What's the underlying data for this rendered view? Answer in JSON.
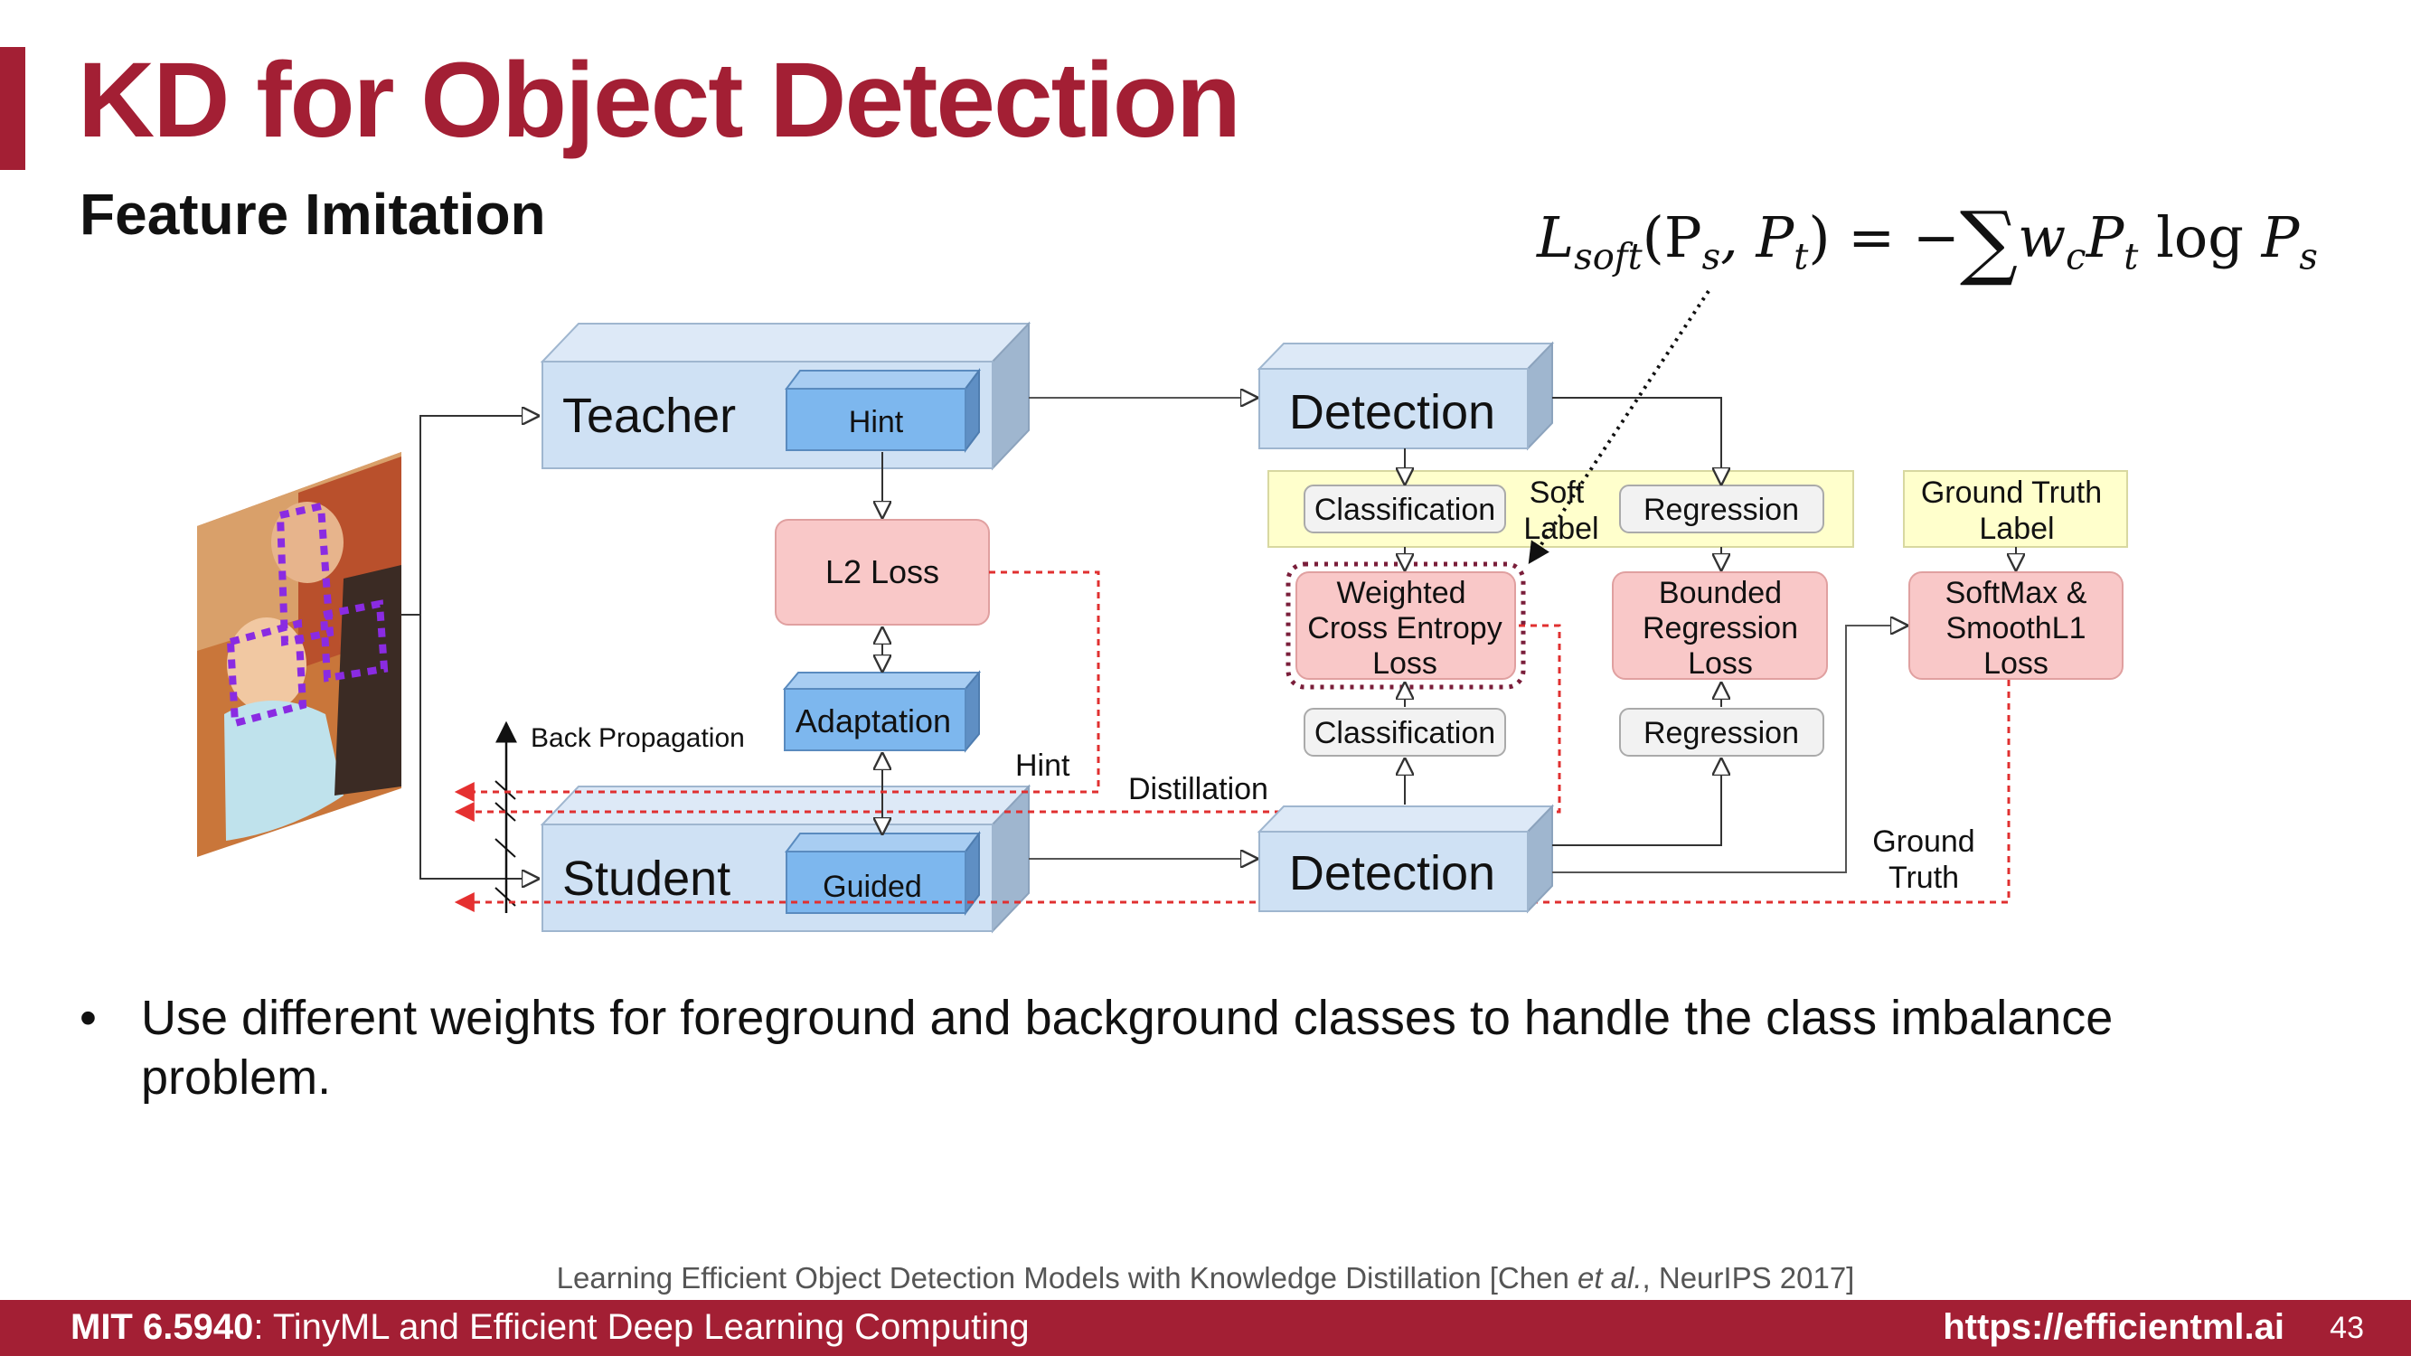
{
  "slide": {
    "title": "KD for Object Detection",
    "subtitle": "Feature Imitation",
    "formula": {
      "lhs_symbol": "L",
      "lhs_sub": "soft",
      "args": "(P",
      "arg1_sub": "s",
      "arg_sep": ", P",
      "arg2_sub": "t",
      "rhs_start": ") = −",
      "sum": "∑",
      "w": "w",
      "w_sub": "c",
      "p": "P",
      "p_sub": "t",
      "log": "log",
      "ps": "P",
      "ps_sub": "s"
    },
    "bullet": "Use different weights for foreground and background classes to handle the class imbalance problem.",
    "citation_prefix": "Learning Efficient Object Detection Models with Knowledge Distillation [Chen ",
    "citation_italic": "et al.",
    "citation_suffix": ", NeurIPS 2017]",
    "footer": {
      "course_code": "MIT 6.5940",
      "course_title": ": TinyML and Efficient Deep Learning Computing",
      "url": "https://efficientml.ai",
      "page": "43"
    }
  },
  "diagram": {
    "teacher": "Teacher",
    "teacher_hint": "Hint",
    "student": "Student",
    "student_guided": "Guided",
    "l2_loss": "L2 Loss",
    "adaptation": "Adaptation",
    "back_propagation": "Back Propagation",
    "hint": "Hint",
    "distillation": "Distillation",
    "detection_top": "Detection",
    "detection_bottom": "Detection",
    "classification_top": "Classification",
    "regression_top": "Regression",
    "soft_label_1": "Soft",
    "soft_label_2": "Label",
    "ground_truth_label_1": "Ground Truth",
    "ground_truth_label_2": "Label",
    "wce_1": "Weighted",
    "wce_2": "Cross Entropy",
    "wce_3": "Loss",
    "brl_1": "Bounded",
    "brl_2": "Regression",
    "brl_3": "Loss",
    "sm_1": "SoftMax &",
    "sm_2": "SmoothL1",
    "sm_3": "Loss",
    "classification_bottom": "Classification",
    "regression_bottom": "Regression",
    "ground_truth_1": "Ground",
    "ground_truth_2": "Truth"
  },
  "colors": {
    "accent": "#a31f34",
    "box_front": "#cfe1f4",
    "box_side": "#9fb6cf",
    "inner_blue": "#7db7ee",
    "loss_pink": "#f9c8c8",
    "label_yellow": "#ffffcc",
    "dashed_red": "#e03030",
    "dotted_purple": "#7a1e3a"
  }
}
